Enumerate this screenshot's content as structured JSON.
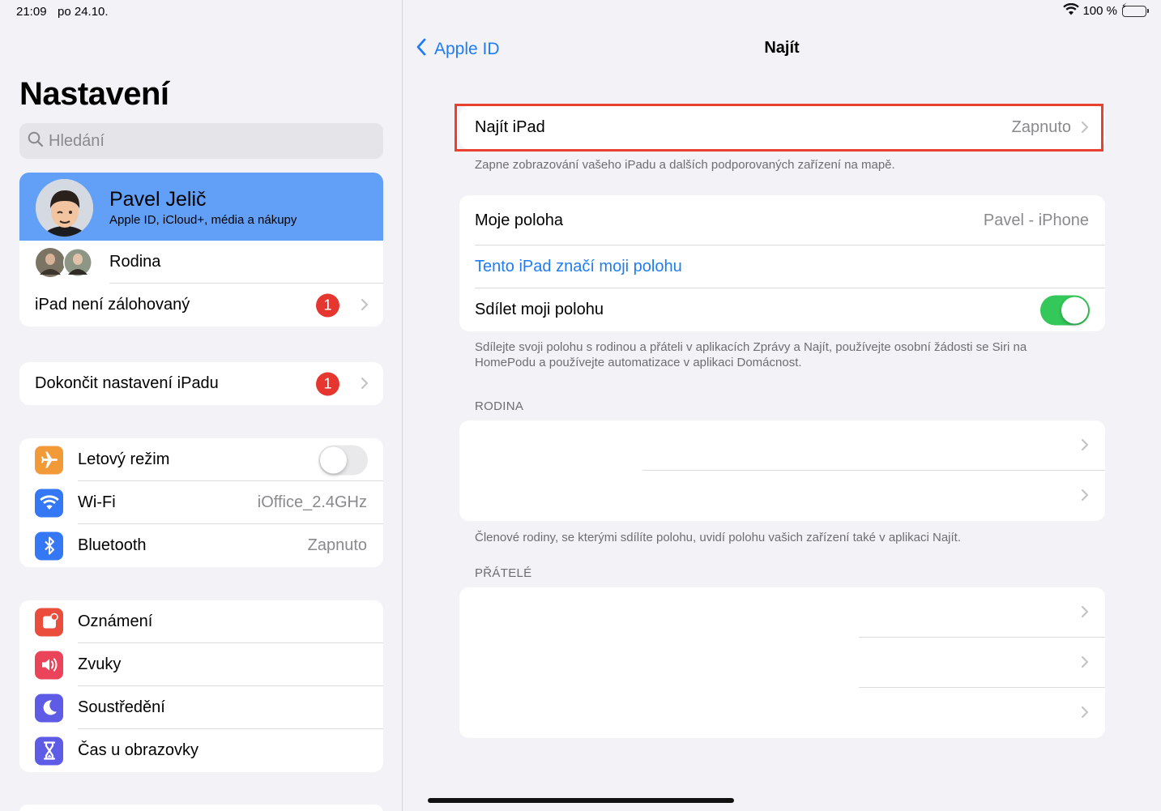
{
  "status_bar": {
    "time": "21:09",
    "date": "po 24.10.",
    "battery": "100 %"
  },
  "sidebar": {
    "title": "Nastavení",
    "search_placeholder": "Hledání",
    "profile": {
      "name": "Pavel Jelič",
      "subtitle": "Apple ID, iCloud+, média a nákupy"
    },
    "family_label": "Rodina",
    "backup": {
      "label": "iPad není zálohovaný",
      "badge": "1"
    },
    "setup": {
      "label": "Dokončit nastavení iPadu",
      "badge": "1"
    },
    "connectivity": [
      {
        "label": "Letový režim",
        "icon": "airplane-icon",
        "color": "#f19a37",
        "toggle": false
      },
      {
        "label": "Wi-Fi",
        "icon": "wifi-icon",
        "color": "#3478f6",
        "value": "iOffice_2.4GHz"
      },
      {
        "label": "Bluetooth",
        "icon": "bluetooth-icon",
        "color": "#3478f6",
        "value": "Zapnuto"
      }
    ],
    "general": [
      {
        "label": "Oznámení",
        "icon": "bell-icon",
        "color": "#eb4d3d"
      },
      {
        "label": "Zvuky",
        "icon": "speaker-icon",
        "color": "#eb445a"
      },
      {
        "label": "Soustředění",
        "icon": "moon-icon",
        "color": "#5e5ce6"
      },
      {
        "label": "Čas u obrazovky",
        "icon": "hourglass-icon",
        "color": "#5e5ce6"
      }
    ]
  },
  "detail": {
    "back_label": "Apple ID",
    "title": "Najít",
    "find_ipad": {
      "label": "Najít iPad",
      "value": "Zapnuto"
    },
    "find_ipad_note": "Zapne zobrazování vašeho iPadu a dalších podporovaných zařízení na mapě.",
    "my_location": {
      "label": "Moje poloha",
      "value": "Pavel - iPhone"
    },
    "use_this_ipad": "Tento iPad značí moji polohu",
    "share_location": {
      "label": "Sdílet moji polohu",
      "on": true
    },
    "share_note": "Sdílejte svoji polohu s rodinou a přáteli v aplikacích Zprávy a Najít, používejte osobní žádosti se Siri na HomePodu a používejte automatizace v aplikaci Domácnost.",
    "family_header": "RODINA",
    "family_note": "Členové rodiny, se kterými sdílíte polohu, uvidí polohu vašich zařízení také v aplikaci Najít.",
    "friends_header": "PŘÁTELÉ"
  },
  "colors": {
    "accent": "#1f7cf6",
    "toggle_on": "#34c759",
    "badge": "#e5372f",
    "profile_bg": "#62a0f8",
    "highlight": "#e8412f"
  }
}
